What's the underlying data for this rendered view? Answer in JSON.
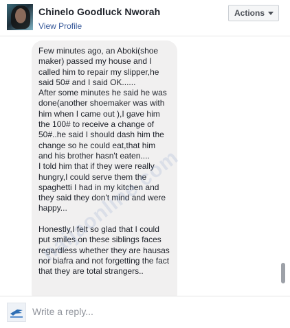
{
  "header": {
    "name": "Chinelo Goodluck Nworah",
    "profile_link": "View Profile",
    "actions_label": "Actions"
  },
  "message": {
    "text": "Few minutes ago, an Aboki(shoe maker) passed my house and I called him to repair my slipper,he said 50# and I said OK......\nAfter some minutes he said he was done(another shoemaker was with him when I came out ),I gave him the 100# to receive a change of 50#..he said I should dash him the change so he could eat,that him and his brother hasn't eaten....\nI told him that if they were really hungry,I could serve them the spaghetti I had in my kitchen and they said they don't mind and were happy...\n\nHonestly,I felt so glad that I could put smiles on these siblings faces regardless whether they are hausas nor biafra and not forgetting the fact that they are total strangers.."
  },
  "watermark": "naijaonline.com",
  "composer": {
    "placeholder": "Write a reply..."
  },
  "icons": {
    "avatar": "profile-photo",
    "caret": "caret-down-icon",
    "composer_avatar": "bird-logo"
  }
}
